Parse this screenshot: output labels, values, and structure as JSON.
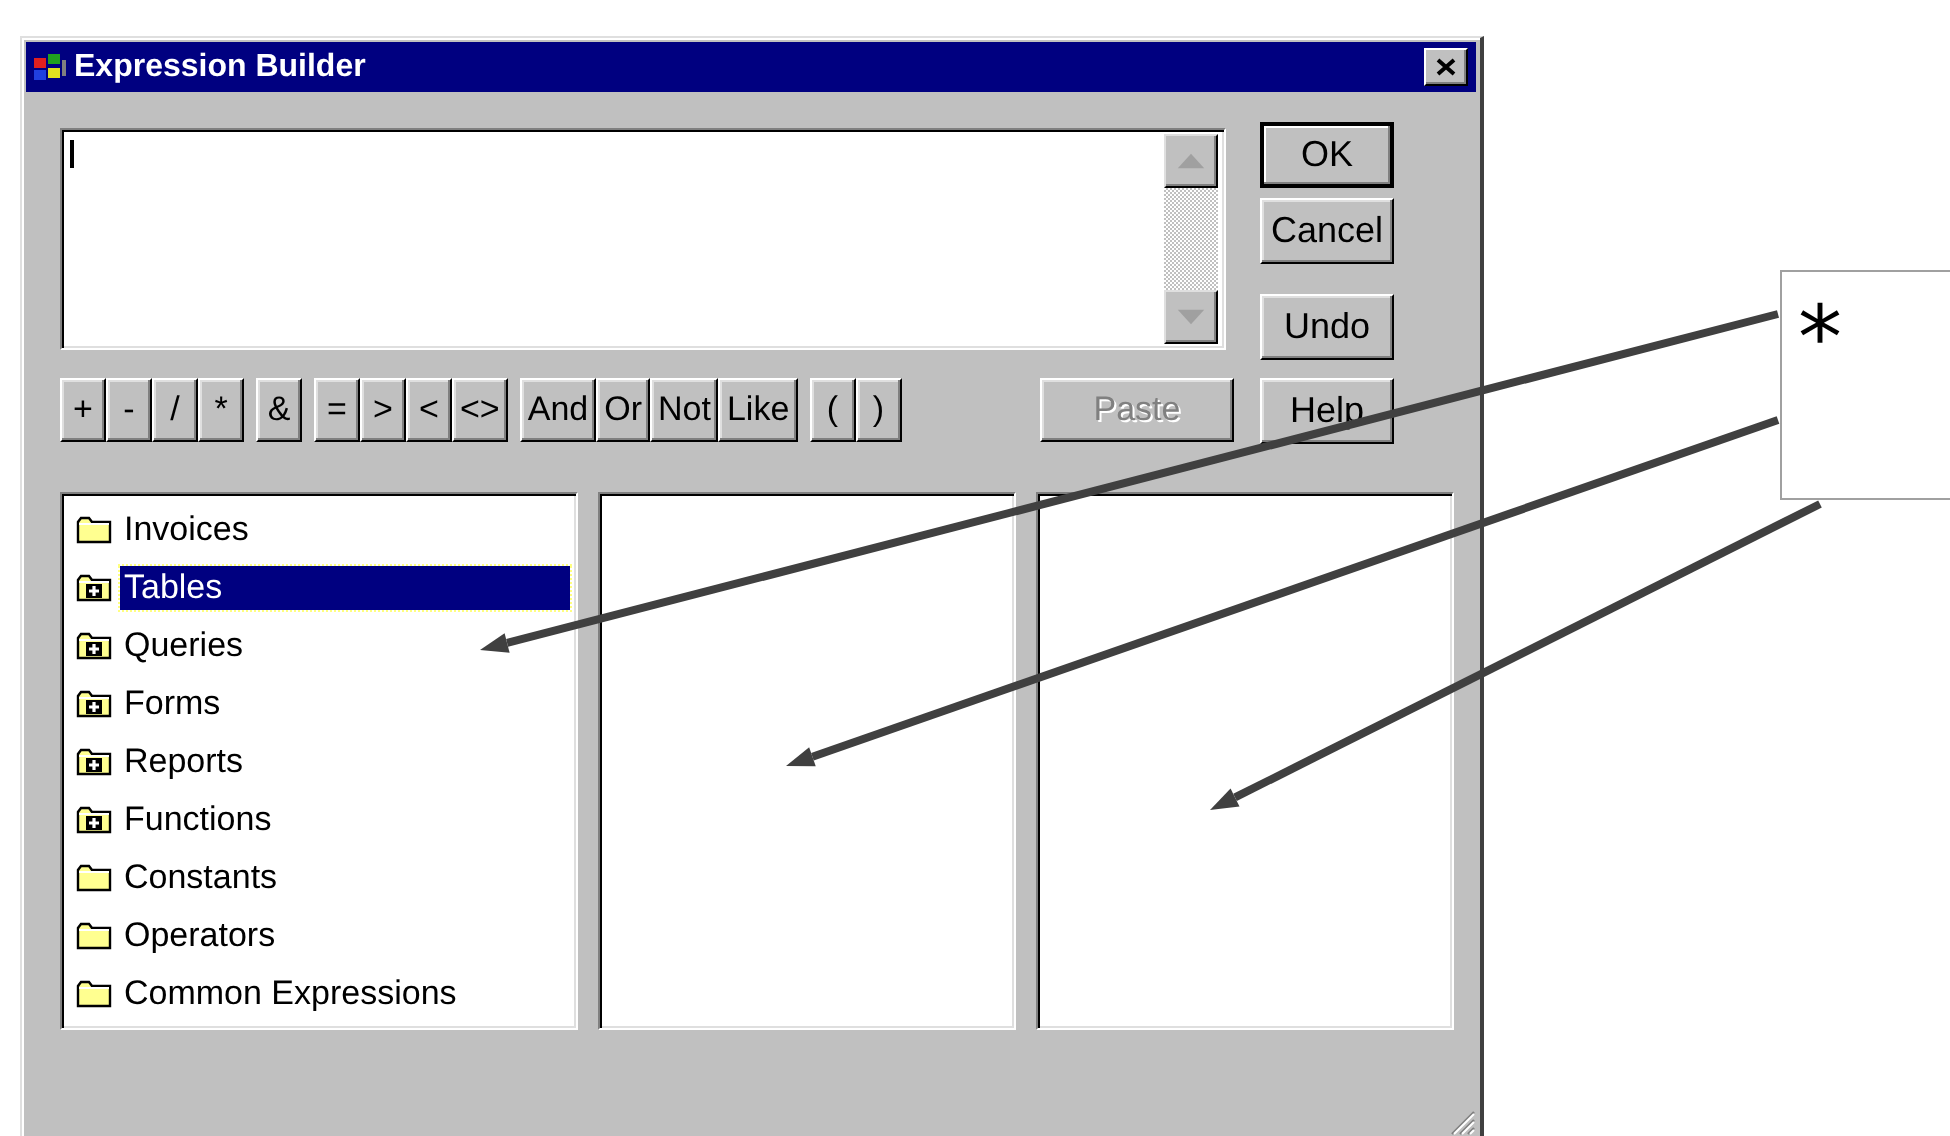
{
  "window": {
    "title": "Expression Builder"
  },
  "operator_groups": [
    [
      "+",
      "-",
      "/",
      "*"
    ],
    [
      "&"
    ],
    [
      "=",
      ">",
      "<",
      "<>"
    ],
    [
      "And",
      "Or",
      "Not",
      "Like"
    ],
    [
      "(",
      ")"
    ]
  ],
  "paste_button": {
    "label": "Paste",
    "disabled": true
  },
  "dialog_buttons": [
    {
      "label": "OK",
      "default": true,
      "disabled": false
    },
    {
      "label": "Cancel",
      "default": false,
      "disabled": false
    },
    {
      "label": "Undo",
      "default": false,
      "disabled": false
    },
    {
      "label": "Help",
      "default": false,
      "disabled": false
    }
  ],
  "tree": [
    {
      "label": "Invoices",
      "kind": "folder",
      "selected": false
    },
    {
      "label": "Tables",
      "kind": "expandable",
      "selected": true
    },
    {
      "label": "Queries",
      "kind": "expandable",
      "selected": false
    },
    {
      "label": "Forms",
      "kind": "expandable",
      "selected": false
    },
    {
      "label": "Reports",
      "kind": "expandable",
      "selected": false
    },
    {
      "label": "Functions",
      "kind": "expandable",
      "selected": false
    },
    {
      "label": "Constants",
      "kind": "folder",
      "selected": false
    },
    {
      "label": "Operators",
      "kind": "folder",
      "selected": false
    },
    {
      "label": "Common Expressions",
      "kind": "folder",
      "selected": false
    }
  ],
  "callout": {
    "text": "*"
  }
}
